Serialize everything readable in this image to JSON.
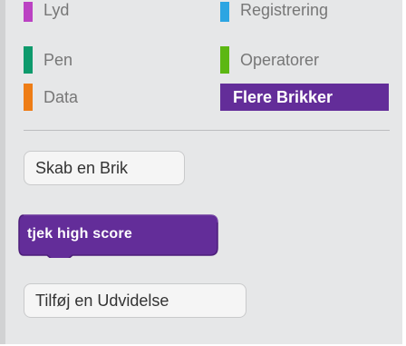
{
  "categories": {
    "left": [
      {
        "label": "Lyd",
        "color": "#bb42c3"
      },
      {
        "label": "Pen",
        "color": "#0e9a6c"
      },
      {
        "label": "Data",
        "color": "#ee7d16"
      }
    ],
    "right": [
      {
        "label": "Registrering",
        "color": "#2ca5e2"
      },
      {
        "label": "Operatorer",
        "color": "#5cb712"
      },
      {
        "label": "Flere Brikker",
        "color": "#632d99",
        "selected": true
      }
    ]
  },
  "buttons": {
    "make_block": "Skab en Brik",
    "add_extension": "Tilføj en Udvidelse"
  },
  "custom_block": {
    "label": "tjek high score",
    "color": "#632d99",
    "border_color": "#4d1f7a"
  }
}
